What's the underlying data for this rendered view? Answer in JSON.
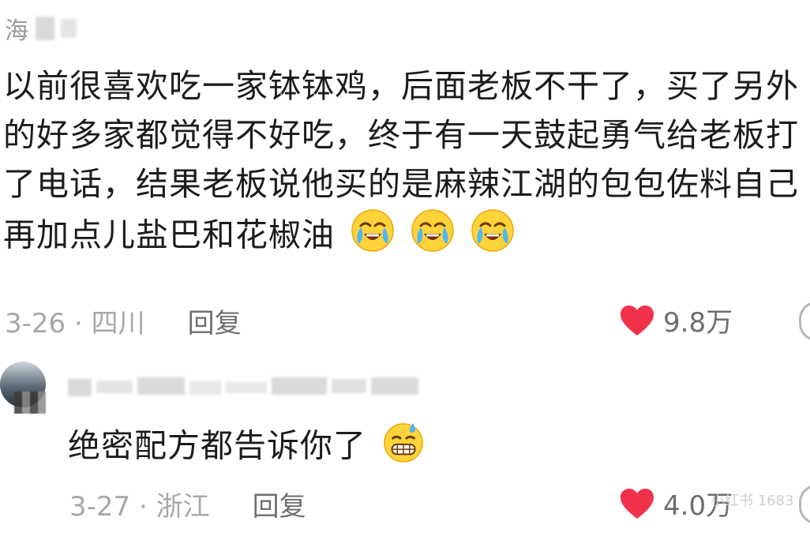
{
  "comment": {
    "username_partial": "海",
    "text_lines": [
      "以前很喜欢吃一家钵钵鸡，后面老板不干了，买了另外",
      "的好多家都觉得不好吃，终于有一天鼓起勇气给老板打",
      "了电话，结果老板说他买的是麻辣江湖的包包佐料自己",
      "再加点儿盐巴和花椒油"
    ],
    "emojis": [
      "crying-laughing-emoji",
      "crying-laughing-emoji",
      "crying-laughing-emoji"
    ],
    "date_location": "3-26 · 四川",
    "reply_label": "回复",
    "likes": "9.8万"
  },
  "reply": {
    "text": "绝密配方都告诉你了",
    "emoji": "grimacing-sweat-emoji",
    "date_location": "3-27 · 浙江",
    "reply_label": "回复",
    "likes": "4.0万"
  },
  "watermark": "小红书 1683",
  "colors": {
    "heart": "#f2324a",
    "text": "#1c1c1c",
    "meta": "#a8a8a8",
    "reply_link": "#6f6f6f"
  }
}
